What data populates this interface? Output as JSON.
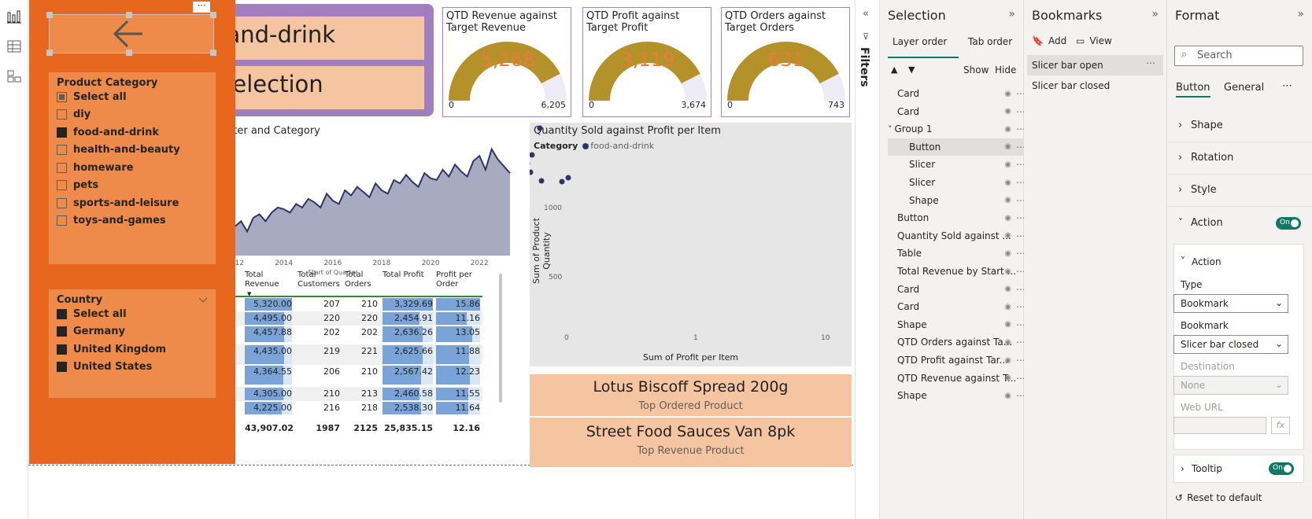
{
  "header": {
    "line1": "-and-drink",
    "line2": "Selection"
  },
  "cards": [
    {
      "title": "QTD Revenue against Target Revenue",
      "value": "5,268",
      "min": "0",
      "max": "6,205",
      "fraction": 0.849
    },
    {
      "title": "QTD Profit against Target Profit",
      "value": "3,119",
      "min": "0",
      "max": "3,674",
      "fraction": 0.849
    },
    {
      "title": "QTD Orders against Target Orders",
      "value": "631",
      "min": "0",
      "max": "743",
      "fraction": 0.849
    }
  ],
  "line_chart": {
    "title": "arter and Category",
    "xlabel": "Start of Quarter",
    "ticks": [
      "2012",
      "2014",
      "2016",
      "2018",
      "2020",
      "2022"
    ]
  },
  "chart_data": {
    "type": "area",
    "x": [
      2011.5,
      2011.75,
      2012,
      2012.25,
      2012.5,
      2012.75,
      2013,
      2013.25,
      2013.5,
      2013.75,
      2014,
      2014.25,
      2014.5,
      2014.75,
      2015,
      2015.25,
      2015.5,
      2015.75,
      2016,
      2016.25,
      2016.5,
      2016.75,
      2017,
      2017.25,
      2017.5,
      2017.75,
      2018,
      2018.25,
      2018.5,
      2018.75,
      2019,
      2019.25,
      2019.5,
      2019.75,
      2020,
      2020.25,
      2020.5,
      2020.75,
      2021,
      2021.25,
      2021.5,
      2021.75,
      2022,
      2022.25,
      2022.5,
      2022.75,
      2023,
      2023.25
    ],
    "values": [
      15,
      18,
      17,
      20,
      14,
      22,
      24,
      20,
      25,
      28,
      27,
      25,
      30,
      28,
      33,
      31,
      28,
      36,
      32,
      30,
      38,
      35,
      40,
      37,
      34,
      42,
      38,
      36,
      44,
      42,
      47,
      43,
      40,
      48,
      45,
      44,
      50,
      46,
      53,
      49,
      46,
      55,
      58,
      50,
      62,
      56,
      52,
      48
    ]
  },
  "table": {
    "headers": [
      "Total Revenue",
      "Total Customers",
      "Total Orders",
      "Total Profit",
      "Profit per Order"
    ],
    "rows": [
      {
        "prefix": "",
        "cells": [
          "5,320.00",
          "207",
          "210",
          "3,329.69",
          "15.86"
        ],
        "rev": 1.0,
        "profit": 1.0,
        "ppo": 1.0
      },
      {
        "prefix": "",
        "cells": [
          "4,495.00",
          "220",
          "220",
          "2,454.91",
          "11.16"
        ],
        "rev": 0.84,
        "profit": 0.74,
        "ppo": 0.7
      },
      {
        "prefix": "n",
        "cells": [
          "4,457.88",
          "202",
          "202",
          "2,636.26",
          "13.05"
        ],
        "rev": 0.83,
        "profit": 0.79,
        "ppo": 0.82
      },
      {
        "prefix": "n",
        "cells": [
          "4,435.00",
          "219",
          "221",
          "2,625.66",
          "11.88"
        ],
        "rev": 0.83,
        "profit": 0.79,
        "ppo": 0.75
      },
      {
        "prefix": "l",
        "cells": [
          "4,364.55",
          "206",
          "210",
          "2,567.42",
          "12.23"
        ],
        "rev": 0.82,
        "profit": 0.77,
        "ppo": 0.77
      },
      {
        "prefix": "",
        "cells": [
          "4,305.00",
          "210",
          "213",
          "2,460.58",
          "11.55"
        ],
        "rev": 0.81,
        "profit": 0.74,
        "ppo": 0.73
      },
      {
        "prefix": "",
        "cells": [
          "4,225.00",
          "216",
          "218",
          "2,538.30",
          "11.64"
        ],
        "rev": 0.79,
        "profit": 0.76,
        "ppo": 0.73
      }
    ],
    "totals": [
      "43,907.02",
      "1987",
      "2125",
      "25,835.15",
      "12.16"
    ]
  },
  "scatter": {
    "title": "Quantity Sold against Profit per Item",
    "legend_label": "Category",
    "legend_item": "food-and-drink",
    "xlabel": "Sum of Profit per Item",
    "ylabel": "Sum of Product Quantity",
    "xticks": [
      "0",
      "1",
      "10"
    ],
    "yticks": [
      "1000",
      "500"
    ]
  },
  "top_products": [
    {
      "name": "Lotus Biscoff Spread 200g",
      "label": "Top Ordered Product"
    },
    {
      "name": "Street Food Sauces Van 8pk",
      "label": "Top Revenue Product"
    }
  ],
  "slicer": {
    "category_title": "Product Category",
    "categories": [
      {
        "label": "Select all",
        "state": "partial"
      },
      {
        "label": "diy",
        "state": "off"
      },
      {
        "label": "food-and-drink",
        "state": "on"
      },
      {
        "label": "health-and-beauty",
        "state": "off"
      },
      {
        "label": "homeware",
        "state": "off"
      },
      {
        "label": "pets",
        "state": "off"
      },
      {
        "label": "sports-and-leisure",
        "state": "off"
      },
      {
        "label": "toys-and-games",
        "state": "off"
      }
    ],
    "country_title": "Country",
    "countries": [
      {
        "label": "Select all",
        "state": "on"
      },
      {
        "label": "Germany",
        "state": "on"
      },
      {
        "label": "United Kingdom",
        "state": "on"
      },
      {
        "label": "United States",
        "state": "on"
      }
    ]
  },
  "filters": {
    "label": "Filters"
  },
  "selection": {
    "title": "Selection",
    "tab_layer": "Layer order",
    "tab_tab": "Tab order",
    "show": "Show",
    "hide": "Hide",
    "items": [
      {
        "label": "Card",
        "indent": 0
      },
      {
        "label": "Card",
        "indent": 0
      },
      {
        "label": "Group 1",
        "indent": 0,
        "group": true
      },
      {
        "label": "Button",
        "indent": 1,
        "selected": true
      },
      {
        "label": "Slicer",
        "indent": 1
      },
      {
        "label": "Slicer",
        "indent": 1
      },
      {
        "label": "Shape",
        "indent": 1
      },
      {
        "label": "Button",
        "indent": 0
      },
      {
        "label": "Quantity Sold against ...",
        "indent": 0
      },
      {
        "label": "Table",
        "indent": 0
      },
      {
        "label": "Total Revenue by Start ...",
        "indent": 0
      },
      {
        "label": "Card",
        "indent": 0
      },
      {
        "label": "Card",
        "indent": 0
      },
      {
        "label": "Shape",
        "indent": 0
      },
      {
        "label": "QTD Orders against Ta...",
        "indent": 0
      },
      {
        "label": "QTD Profit against Tar...",
        "indent": 0
      },
      {
        "label": "QTD Revenue against T...",
        "indent": 0
      },
      {
        "label": "Shape",
        "indent": 0
      }
    ]
  },
  "bookmarks": {
    "title": "Bookmarks",
    "add": "Add",
    "view": "View",
    "items": [
      "Slicer bar open",
      "Slicer bar closed"
    ]
  },
  "format": {
    "title": "Format",
    "search_placeholder": "Search",
    "tab_button": "Button",
    "tab_general": "General",
    "sections": [
      "Shape",
      "Rotation",
      "Style"
    ],
    "action_title": "Action",
    "action_toggle": "On",
    "sub_action": "Action",
    "type_label": "Type",
    "type_value": "Bookmark",
    "bookmark_label": "Bookmark",
    "bookmark_value": "Slicer bar closed",
    "destination_label": "Destination",
    "destination_value": "None",
    "weburl_label": "Web URL",
    "tooltip_label": "Tooltip",
    "tooltip_toggle": "On",
    "reset": "Reset to default"
  },
  "colors": {
    "accent_orange": "#e8671f",
    "gauge_fill": "#b5912a",
    "area_fill": "#a7aac1",
    "line": "#2f3568",
    "header_purple": "#a17ebd",
    "peach": "#f5c4a1"
  }
}
